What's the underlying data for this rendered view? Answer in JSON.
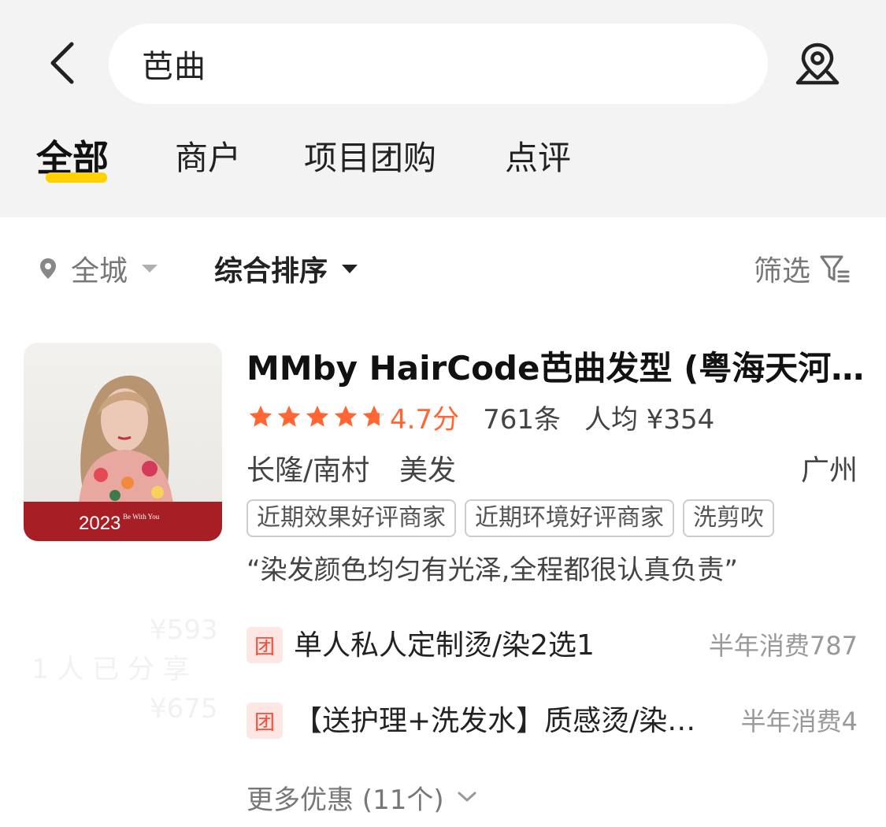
{
  "search": {
    "query": "芭曲"
  },
  "tabs": [
    {
      "label": "全部",
      "active": true
    },
    {
      "label": "商户",
      "active": false
    },
    {
      "label": "项目团购",
      "active": false
    },
    {
      "label": "点评",
      "active": false
    }
  ],
  "filters": {
    "city": "全城",
    "sort": "综合排序",
    "filter": "筛选"
  },
  "shop": {
    "title": "MMby HairCode芭曲发型 (粤海天河…",
    "rating": 4.7,
    "score_label": "4.7分",
    "reviews": "761条",
    "avg_price": "人均 ¥354",
    "area": "长隆/南村",
    "category": "美发",
    "city": "广州",
    "tags": [
      "近期效果好评商家",
      "近期环境好评商家",
      "洗剪吹"
    ],
    "quote": "“染发颜色均匀有光泽,全程都很认真负责”",
    "thumb_year": "2023",
    "thumb_caption": "Be With You",
    "deals": [
      {
        "badge": "团",
        "title": "单人私人定制烫/染2选1",
        "sales": "半年消费787"
      },
      {
        "badge": "团",
        "title": "【送护理+洗发水】质感烫/染…",
        "sales": "半年消费4"
      }
    ],
    "more": "更多优惠 (11个)"
  },
  "colors": {
    "accent_yellow": "#ffd200",
    "rating_orange": "#ff6633",
    "deal_red": "#ff4a36",
    "header_bg": "#f3f3f3"
  }
}
